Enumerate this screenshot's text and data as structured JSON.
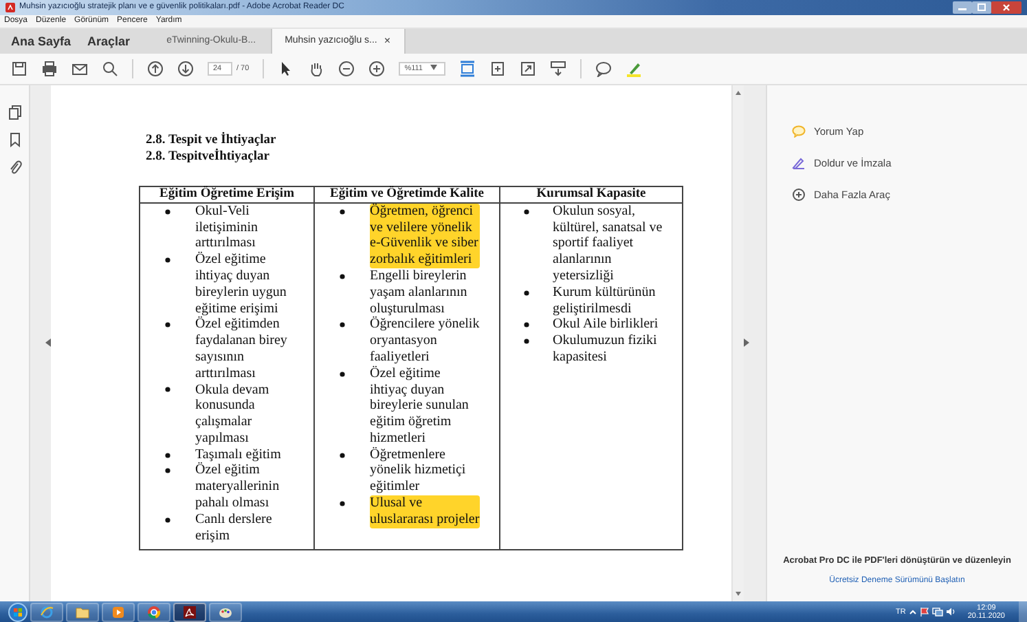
{
  "window": {
    "title": "Muhsin yazıcıoğlu stratejik planı ve e güvenlik politikaları.pdf - Adobe Acrobat Reader DC"
  },
  "menu": [
    "Dosya",
    "Düzenle",
    "Görünüm",
    "Pencere",
    "Yardım"
  ],
  "tabs": [
    {
      "label": "Ana Sayfa",
      "kind": "nav"
    },
    {
      "label": "Araçlar",
      "kind": "nav"
    },
    {
      "label": "eTwinning-Okulu-B...",
      "kind": "document",
      "selected": false
    },
    {
      "label": "Muhsin yazıcıoğlu s...",
      "kind": "document",
      "selected": true,
      "close": "×"
    }
  ],
  "toolbar": {
    "page": "24",
    "page_count": "/ 70",
    "zoom": "%111"
  },
  "document": {
    "headings": [
      "2.8. Tespit ve İhtiyaçlar",
      "2.8. Tespitveİhtiyaçlar"
    ],
    "table": {
      "columns": [
        "Eğitim Öğretime Erişim",
        "Eğitim ve Öğretimde Kalite",
        "Kurumsal Kapasite"
      ],
      "cells": [
        [
          {
            "text": "Okul-Veli iletişiminin arttırılması",
            "highlighted": false
          },
          {
            "text": "Özel eğitime ihtiyaç duyan bireylerin uygun eğitime erişimi",
            "highlighted": false
          },
          {
            "text": "Özel eğitimden faydalanan birey sayısının arttırılması",
            "highlighted": false
          },
          {
            "text": "Okula devam konusunda çalışmalar yapılması",
            "highlighted": false
          },
          {
            "text": "Taşımalı eğitim",
            "highlighted": false
          },
          {
            "text": "Özel eğitim materyallerinin pahalı olması",
            "highlighted": false
          },
          {
            "text": "Canlı derslere erişim",
            "highlighted": false
          }
        ],
        [
          {
            "text": "Öğretmen, öğrenci ve velilere yönelik e-Güvenlik ve siber zorbalık eğitimleri",
            "highlighted": true
          },
          {
            "text": "Engelli bireylerin yaşam alanlarının oluşturulması",
            "highlighted": false
          },
          {
            "text": "Öğrencilere yönelik oryantasyon faaliyetleri",
            "highlighted": false
          },
          {
            "text": "Özel eğitime ihtiyaç duyan bireylerie sunulan eğitim öğretim hizmetleri",
            "highlighted": false
          },
          {
            "text": "Öğretmenlere yönelik hizmetiçi eğitimler",
            "highlighted": false
          },
          {
            "text": "Ulusal ve uluslararası projeler",
            "highlighted": true
          }
        ],
        [
          {
            "text": "Okulun sosyal, kültürel, sanatsal ve sportif faaliyet alanlarının yetersizliği",
            "highlighted": false
          },
          {
            "text": "Kurum kültürünün geliştirilmesdi",
            "highlighted": false
          },
          {
            "text": "Okul Aile birlikleri",
            "highlighted": false
          },
          {
            "text": "Okulumuzun fiziki kapasitesi",
            "highlighted": false
          }
        ]
      ]
    }
  },
  "tools_panel": {
    "items": [
      {
        "label": "Yorum Yap",
        "kind": "comment"
      },
      {
        "label": "Doldur ve İmzala",
        "kind": "sign"
      },
      {
        "label": "Daha Fazla Araç",
        "kind": "more"
      }
    ],
    "promo": {
      "text": "Acrobat Pro DC ile PDF'leri dönüştürün ve düzenleyin",
      "link": "Ücretsiz Deneme Sürümünü Başlatın"
    }
  },
  "taskbar": {
    "apps": [
      {
        "kind": "browser",
        "active": false
      },
      {
        "kind": "folder",
        "active": false
      },
      {
        "kind": "media",
        "active": false
      },
      {
        "kind": "chrome",
        "active": false
      },
      {
        "kind": "acrobat",
        "active": true
      },
      {
        "kind": "paint",
        "active": false
      }
    ],
    "language": "TR",
    "time": "12:09",
    "date": "20.11.2020"
  }
}
